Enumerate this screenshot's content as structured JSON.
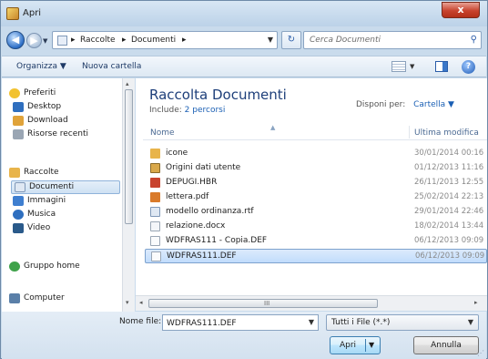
{
  "window": {
    "title": "Apri",
    "close_glyph": "x"
  },
  "nav": {
    "back_glyph": "◀",
    "forward_glyph": "▶",
    "recent_glyph": "▼",
    "breadcrumbs": [
      "Raccolte",
      "Documenti"
    ],
    "separator": "▸",
    "dropdown_glyph": "▼",
    "refresh_glyph": "↻"
  },
  "search": {
    "placeholder": "Cerca Documenti",
    "icon": "search-icon",
    "glyph": "⚲"
  },
  "toolbar": {
    "organize_label": "Organizza ▼",
    "new_folder_label": "Nuova cartella",
    "view_caret": "▼",
    "help_glyph": "?"
  },
  "sidebar": {
    "items": [
      {
        "label": "Preferiti",
        "icon": "star-icon",
        "color": "#f2c230"
      },
      {
        "label": "Desktop",
        "icon": "desktop-icon",
        "color": "#2f6fbf"
      },
      {
        "label": "Download",
        "icon": "download-folder-icon",
        "color": "#e0a33a"
      },
      {
        "label": "Risorse recenti",
        "icon": "recent-places-icon",
        "color": "#9aa6b4"
      },
      {
        "label": "Raccolte",
        "icon": "libraries-icon",
        "color": "#e8b44a"
      },
      {
        "label": "Documenti",
        "icon": "documents-icon",
        "color": "#7f98b8"
      },
      {
        "label": "Immagini",
        "icon": "pictures-icon",
        "color": "#3f7fd0"
      },
      {
        "label": "Musica",
        "icon": "music-icon",
        "color": "#2f6fbf"
      },
      {
        "label": "Video",
        "icon": "video-icon",
        "color": "#2a5a8a"
      },
      {
        "label": "Gruppo home",
        "icon": "homegroup-icon",
        "color": "#3fa24a"
      },
      {
        "label": "Computer",
        "icon": "computer-icon",
        "color": "#5a7fa8"
      }
    ]
  },
  "library": {
    "title": "Raccolta Documenti",
    "include_label": "Include:",
    "include_link": "2 percorsi",
    "arrange_label": "Disponi per:",
    "arrange_value": "Cartella ▼"
  },
  "columns": {
    "name": "Nome",
    "date": "Ultima modifica",
    "sort_glyph": "▲"
  },
  "files": [
    {
      "name": "icone",
      "date": "30/01/2014 00:16",
      "icon": "folder-icon",
      "color": "#e8b44a"
    },
    {
      "name": "Origini dati utente",
      "date": "01/12/2013 11:16",
      "icon": "data-source-folder-icon",
      "color": "#d9a84a"
    },
    {
      "name": "DEPUGI.HBR",
      "date": "26/11/2013 12:55",
      "icon": "hbr-file-icon",
      "color": "#c8432e"
    },
    {
      "name": "lettera.pdf",
      "date": "25/02/2014 22:13",
      "icon": "pdf-file-icon",
      "color": "#d97a2a"
    },
    {
      "name": "modello ordinanza.rtf",
      "date": "29/01/2014 22:46",
      "icon": "rtf-file-icon",
      "color": "#7f98b8"
    },
    {
      "name": "relazione.docx",
      "date": "18/02/2014 13:44",
      "icon": "docx-file-icon",
      "color": "#b9c6d6"
    },
    {
      "name": "WDFRAS111 - Copia.DEF",
      "date": "06/12/2013 09:09",
      "icon": "def-file-icon",
      "color": "#c9d4e2"
    },
    {
      "name": "WDFRAS111.DEF",
      "date": "06/12/2013 09:09",
      "icon": "def-file-icon",
      "color": "#c9d4e2"
    }
  ],
  "scroll": {
    "left_glyph": "◂",
    "right_glyph": "▸",
    "up_glyph": "▴",
    "down_glyph": "▾",
    "grip": "III"
  },
  "footer": {
    "filename_label": "Nome file:",
    "filename_value": "WDFRAS111.DEF",
    "filename_caret": "▼",
    "filter_value": "Tutti i File (*.*)",
    "filter_caret": "▼",
    "open_label": "Apri",
    "open_caret": "▼",
    "cancel_label": "Annulla",
    "grip": "⋰"
  }
}
